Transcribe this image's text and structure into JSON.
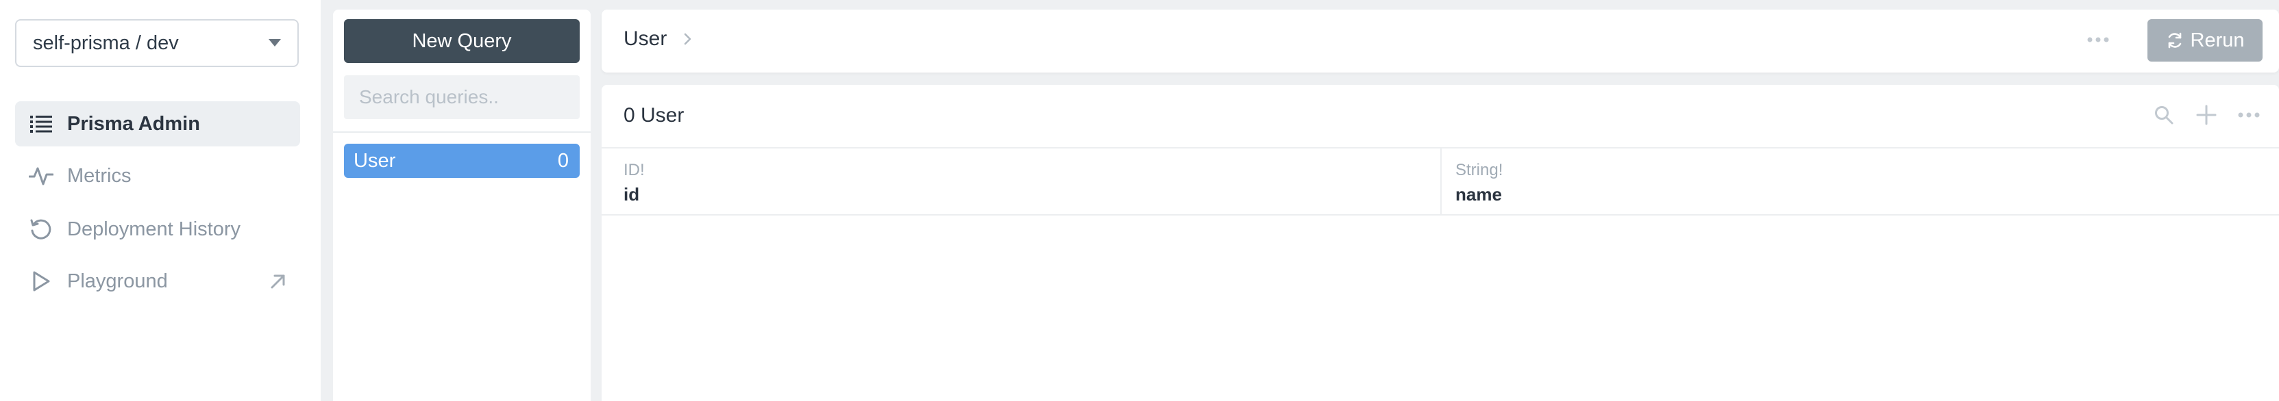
{
  "sidebar": {
    "project": "self-prisma / dev",
    "items": [
      {
        "label": "Prisma Admin",
        "icon": "list-icon"
      },
      {
        "label": "Metrics",
        "icon": "activity-icon"
      },
      {
        "label": "Deployment History",
        "icon": "history-icon"
      },
      {
        "label": "Playground",
        "icon": "play-icon",
        "trailing_icon": "arrow-up-right-icon"
      }
    ]
  },
  "queries": {
    "new_query_label": "New Query",
    "search_placeholder": "Search queries..",
    "models": [
      {
        "name": "User",
        "count": "0"
      }
    ]
  },
  "topbar": {
    "breadcrumb": "User",
    "rerun_label": "Rerun"
  },
  "table": {
    "heading": "0 User",
    "columns": [
      {
        "type": "ID!",
        "name": "id"
      },
      {
        "type": "String!",
        "name": "name"
      }
    ]
  },
  "colors": {
    "active_model": "#5b9de8",
    "primary_button": "#3f4d58",
    "rerun_button": "#a7b0b8",
    "background": "#eef0f2"
  }
}
